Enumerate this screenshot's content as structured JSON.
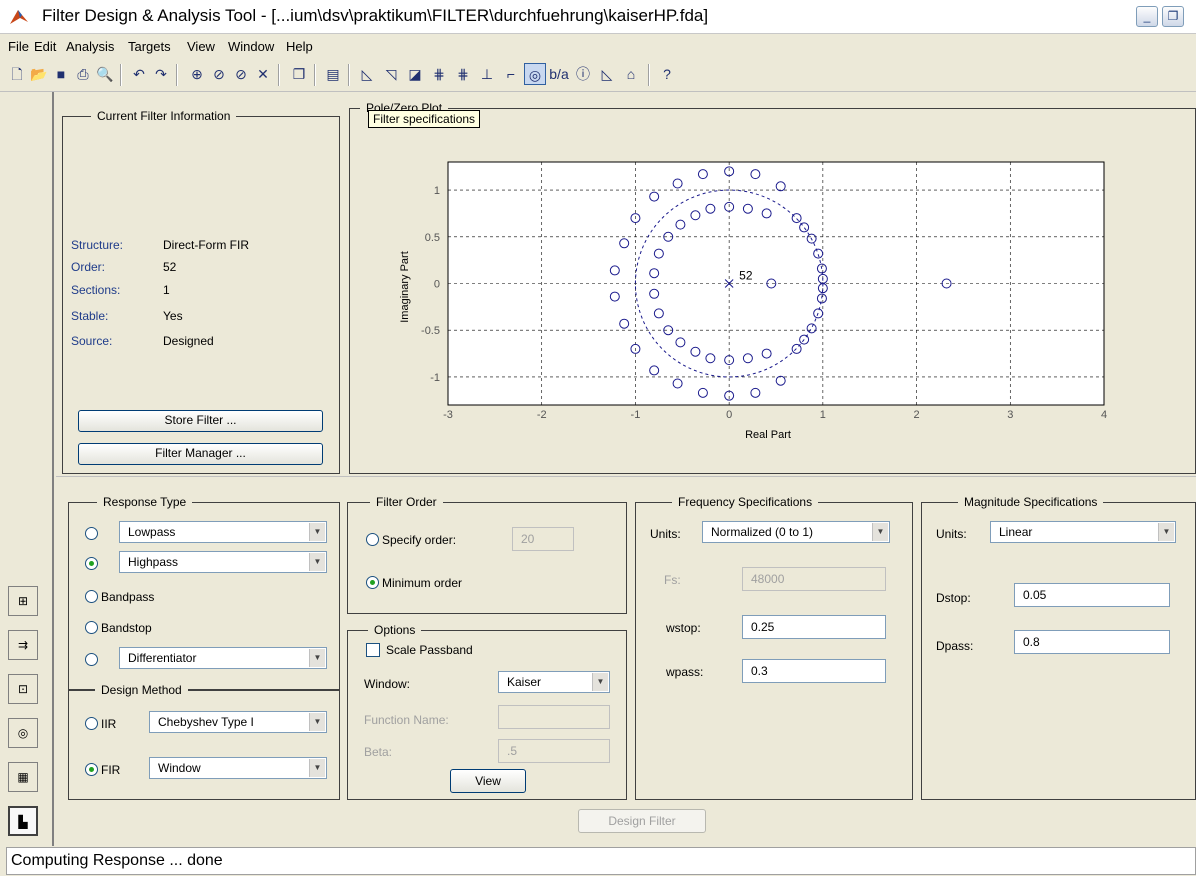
{
  "window": {
    "title": "Filter Design & Analysis Tool - [...ium\\dsv\\praktikum\\FILTER\\durchfuehrung\\kaiserHP.fda]",
    "minimize_glyph": "_",
    "restore_glyph": "❐"
  },
  "menu": [
    "File",
    "Edit",
    "Analysis",
    "Targets",
    "View",
    "Window",
    "Help"
  ],
  "toolbar_icons": [
    "new-icon",
    "open-icon",
    "save-icon",
    "print-icon",
    "print-preview-icon",
    "undo-icon",
    "redo-icon",
    "zoom-in-icon",
    "zoom-x-icon",
    "zoom-y-icon",
    "full-view-icon",
    "new-figure-icon",
    "filter-spec-icon",
    "magnitude-icon",
    "phase-icon",
    "mag-phase-icon",
    "group-delay-icon",
    "phase-delay-icon",
    "impulse-icon",
    "step-icon",
    "pole-zero-icon",
    "coefficients-icon",
    "info-icon",
    "magnitude-estimate-icon",
    "round-off-icon",
    "whats-this-icon"
  ],
  "current_filter": {
    "title": "Current Filter Information",
    "rows": [
      {
        "label": "Structure:",
        "value": "Direct-Form FIR"
      },
      {
        "label": "Order:",
        "value": "52"
      },
      {
        "label": "Sections:",
        "value": "1"
      },
      {
        "label": "Stable:",
        "value": "Yes"
      },
      {
        "label": "Source:",
        "value": "Designed"
      }
    ],
    "store_button": "Store Filter ...",
    "manager_button": "Filter Manager ..."
  },
  "plot": {
    "title": "Pole/Zero Plot",
    "tooltip": "Filter specifications",
    "xlabel": "Real Part",
    "ylabel": "Imaginary Part",
    "multiplicity_label": "52",
    "colors": {
      "zeros": "#1a1a8c",
      "grid": "#000000"
    }
  },
  "chart_data": {
    "type": "scatter",
    "title": "Pole/Zero Plot",
    "xlabel": "Real Part",
    "ylabel": "Imaginary Part",
    "xlim": [
      -3,
      4
    ],
    "ylim": [
      -1.3,
      1.3
    ],
    "xticks": [
      -3,
      -2,
      -1,
      0,
      1,
      2,
      3,
      4
    ],
    "yticks": [
      -1,
      -0.5,
      0,
      0.5,
      1
    ],
    "grid": true,
    "unit_circle": true,
    "poles": [
      {
        "x": 0,
        "y": 0,
        "multiplicity": 52
      }
    ],
    "zeros": [
      [
        0.0,
        1.2
      ],
      [
        0.28,
        1.17
      ],
      [
        0.55,
        1.04
      ],
      [
        -0.28,
        1.17
      ],
      [
        -0.55,
        1.07
      ],
      [
        -0.8,
        0.93
      ],
      [
        -1.0,
        0.7
      ],
      [
        -1.12,
        0.43
      ],
      [
        -1.22,
        0.14
      ],
      [
        0.0,
        -1.2
      ],
      [
        0.28,
        -1.17
      ],
      [
        0.55,
        -1.04
      ],
      [
        -0.28,
        -1.17
      ],
      [
        -0.55,
        -1.07
      ],
      [
        -0.8,
        -0.93
      ],
      [
        -1.0,
        -0.7
      ],
      [
        -1.12,
        -0.43
      ],
      [
        -1.22,
        -0.14
      ],
      [
        0.0,
        0.82
      ],
      [
        0.2,
        0.8
      ],
      [
        0.4,
        0.75
      ],
      [
        -0.2,
        0.8
      ],
      [
        -0.36,
        0.73
      ],
      [
        -0.52,
        0.63
      ],
      [
        -0.65,
        0.5
      ],
      [
        -0.75,
        0.32
      ],
      [
        -0.8,
        0.11
      ],
      [
        0.0,
        -0.82
      ],
      [
        0.2,
        -0.8
      ],
      [
        0.4,
        -0.75
      ],
      [
        -0.2,
        -0.8
      ],
      [
        -0.36,
        -0.73
      ],
      [
        -0.52,
        -0.63
      ],
      [
        -0.65,
        -0.5
      ],
      [
        -0.75,
        -0.32
      ],
      [
        -0.8,
        -0.11
      ],
      [
        0.72,
        0.7
      ],
      [
        0.8,
        0.6
      ],
      [
        0.88,
        0.48
      ],
      [
        0.95,
        0.32
      ],
      [
        0.99,
        0.16
      ],
      [
        1.0,
        0.05
      ],
      [
        0.72,
        -0.7
      ],
      [
        0.8,
        -0.6
      ],
      [
        0.88,
        -0.48
      ],
      [
        0.95,
        -0.32
      ],
      [
        0.99,
        -0.16
      ],
      [
        1.0,
        -0.05
      ],
      [
        0.45,
        0.0
      ],
      [
        2.32,
        0.0
      ]
    ]
  },
  "response_type": {
    "title": "Response Type",
    "lowpass": "Lowpass",
    "highpass": "Highpass",
    "bandpass": "Bandpass",
    "bandstop": "Bandstop",
    "differentiator": "Differentiator",
    "selected": "Highpass"
  },
  "design_method": {
    "title": "Design Method",
    "iir_label": "IIR",
    "iir_value": "Chebyshev Type I",
    "fir_label": "FIR",
    "fir_value": "Window",
    "selected": "FIR"
  },
  "filter_order": {
    "title": "Filter Order",
    "specify_label": "Specify order:",
    "specify_value": "20",
    "minimum_label": "Minimum order",
    "selected": "Minimum order"
  },
  "options": {
    "title": "Options",
    "scale_passband": "Scale Passband",
    "window_label": "Window:",
    "window_value": "Kaiser",
    "function_label": "Function Name:",
    "function_value": "",
    "beta_label": "Beta:",
    "beta_value": ".5",
    "view_button": "View"
  },
  "frequency_specs": {
    "title": "Frequency Specifications",
    "units_label": "Units:",
    "units_value": "Normalized (0 to 1)",
    "fs_label": "Fs:",
    "fs_value": "48000",
    "wstop_label": "wstop:",
    "wstop_value": "0.25",
    "wpass_label": "wpass:",
    "wpass_value": "0.3"
  },
  "magnitude_specs": {
    "title": "Magnitude Specifications",
    "units_label": "Units:",
    "units_value": "Linear",
    "dstop_label": "Dstop:",
    "dstop_value": "0.05",
    "dpass_label": "Dpass:",
    "dpass_value": "0.8"
  },
  "design_button": "Design Filter",
  "status": "Computing Response ... done"
}
